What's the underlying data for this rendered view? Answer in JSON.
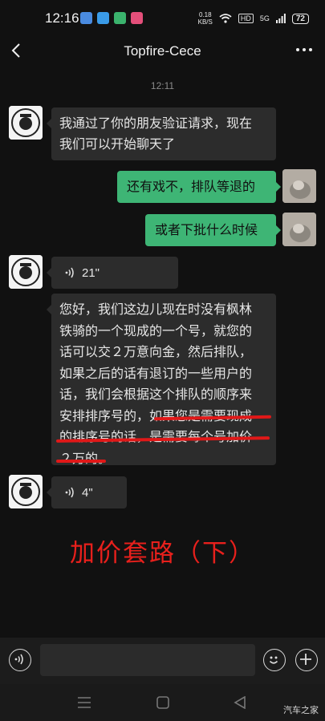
{
  "status_bar": {
    "time": "12:16",
    "net_speed_value": "0.18",
    "net_speed_unit": "KB/S",
    "hd": "HD",
    "signal": "5G",
    "battery": "72"
  },
  "header": {
    "title": "Topfire-Cece"
  },
  "chat": {
    "timestamp": "12:11",
    "messages": [
      {
        "side": "left",
        "type": "text",
        "text_lines": [
          "我通过了你的朋友验证请求，现在",
          "我们可以开始聊天了"
        ]
      },
      {
        "side": "right",
        "type": "text",
        "text": "还有戏不，排队等退的"
      },
      {
        "side": "right",
        "type": "text",
        "text": "或者下批什么时候"
      },
      {
        "side": "left",
        "type": "voice",
        "duration": "21\""
      },
      {
        "side": "left",
        "type": "text",
        "text_lines": [
          "您好，我们这边儿现在时没有枫林",
          "铁骑的一个现成的一个号，就您的",
          "话可以交２万意向金，然后排队，",
          "如果之后的话有退订的一些用户的",
          "话，我们会根据这个排队的顺序来",
          "安排排序号的，如果您是需要现成",
          "的排序号的话，是需要每个号加价",
          "２万的。"
        ]
      },
      {
        "side": "left",
        "type": "voice",
        "duration": "4\""
      }
    ]
  },
  "overlay": {
    "promo_text": "加价套路（下）",
    "watermark": "汽车之家",
    "highlight_color": "#e01818"
  },
  "input_bar": {
    "voice_toggle_icon": "voice-icon",
    "emoji_icon": "emoji-icon",
    "plus_icon": "plus-icon"
  },
  "nav_bar": {
    "menu_icon": "menu-icon",
    "home_icon": "home-icon",
    "back_icon": "back-triangle-icon"
  }
}
